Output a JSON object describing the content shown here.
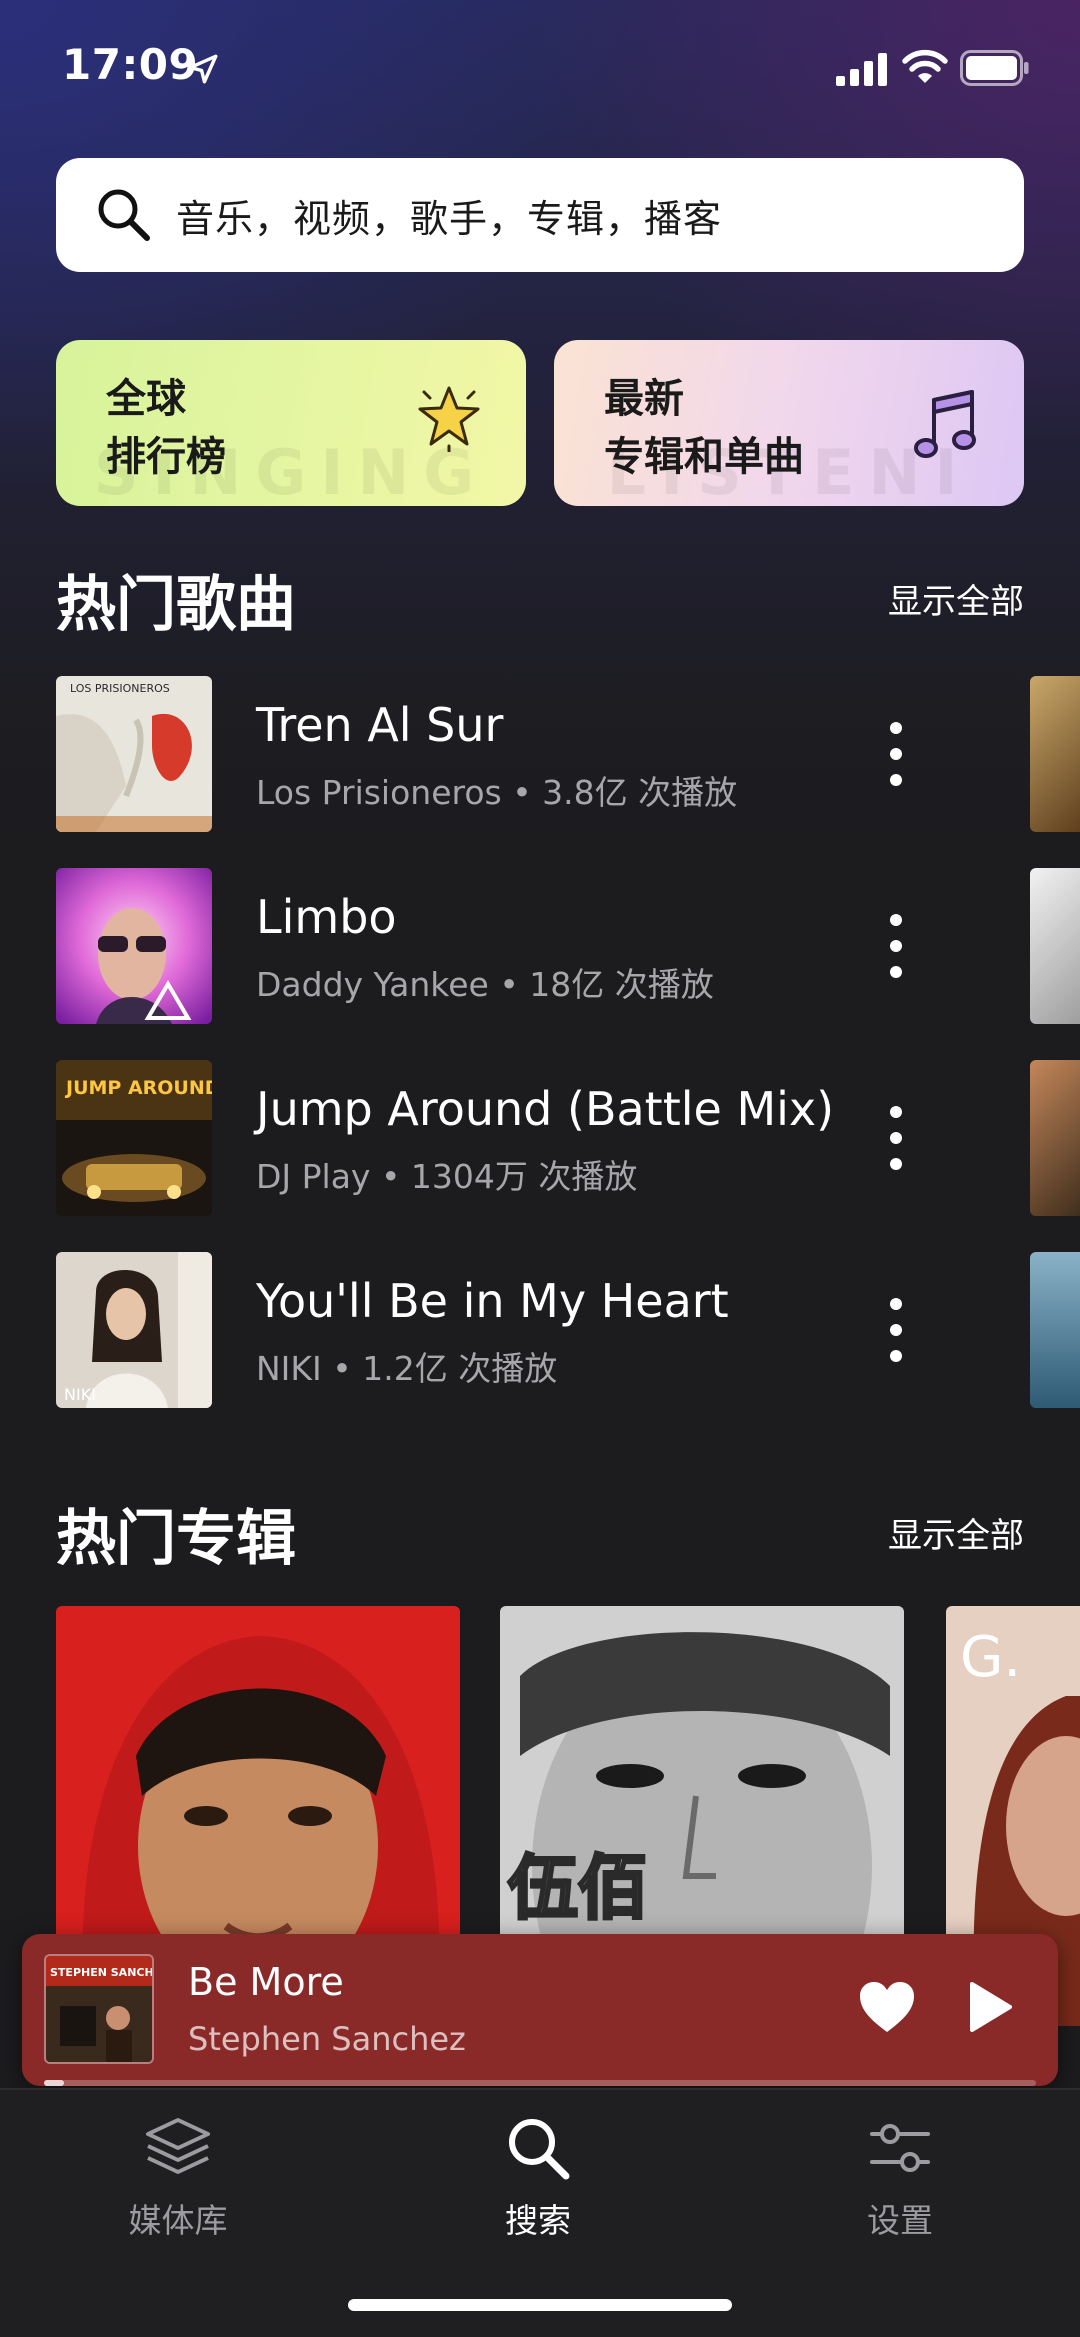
{
  "status_bar": {
    "time": "17:09",
    "icons": [
      "location-arrow-icon",
      "cellular-signal-icon",
      "wifi-icon",
      "battery-icon"
    ]
  },
  "search": {
    "placeholder": "音乐，视频，歌手，专辑，播客",
    "icon": "search-icon"
  },
  "promo_cards": [
    {
      "line1": "全球",
      "line2": "排行榜",
      "icon": "star-icon",
      "watermark": "SINGING"
    },
    {
      "line1": "最新",
      "line2": "专辑和单曲",
      "icon": "music-note-icon",
      "watermark": "LISTENI"
    }
  ],
  "hot_songs": {
    "title": "热门歌曲",
    "show_all": "显示全部",
    "items": [
      {
        "title": "Tren Al Sur",
        "meta": "Los Prisioneros • 3.8亿 次播放",
        "cover_text": "LOS PRISIONEROS"
      },
      {
        "title": "Limbo",
        "meta": "Daddy Yankee • 18亿 次播放",
        "cover_text": ""
      },
      {
        "title": "Jump Around (Battle Mix)",
        "meta": "DJ Play • 1304万 次播放",
        "cover_text": "JUMP AROUND"
      },
      {
        "title": "You'll Be in My Heart",
        "meta": "NIKI • 1.2亿 次播放",
        "cover_text": "NIKI"
      }
    ]
  },
  "hot_albums": {
    "title": "热门专辑",
    "show_all": "显示全部",
    "album_texts": [
      "",
      "伍佰",
      "G."
    ]
  },
  "mini_player": {
    "title": "Be More",
    "artist": "Stephen Sanchez",
    "cover_text": "STEPHEN SANCHEZ",
    "progress": 0.02
  },
  "tab_bar": {
    "tabs": [
      {
        "label": "媒体库",
        "icon": "layers-icon",
        "active": false
      },
      {
        "label": "搜索",
        "icon": "search-icon",
        "active": true
      },
      {
        "label": "设置",
        "icon": "sliders-icon",
        "active": false
      }
    ]
  },
  "colors": {
    "mini_player_bg": "#8a2a28",
    "card_global_charts": "#e2f5a0",
    "card_new_releases": "#f1d7ec",
    "active_tab": "#ffffff",
    "inactive_tab": "#9b9ba0"
  }
}
